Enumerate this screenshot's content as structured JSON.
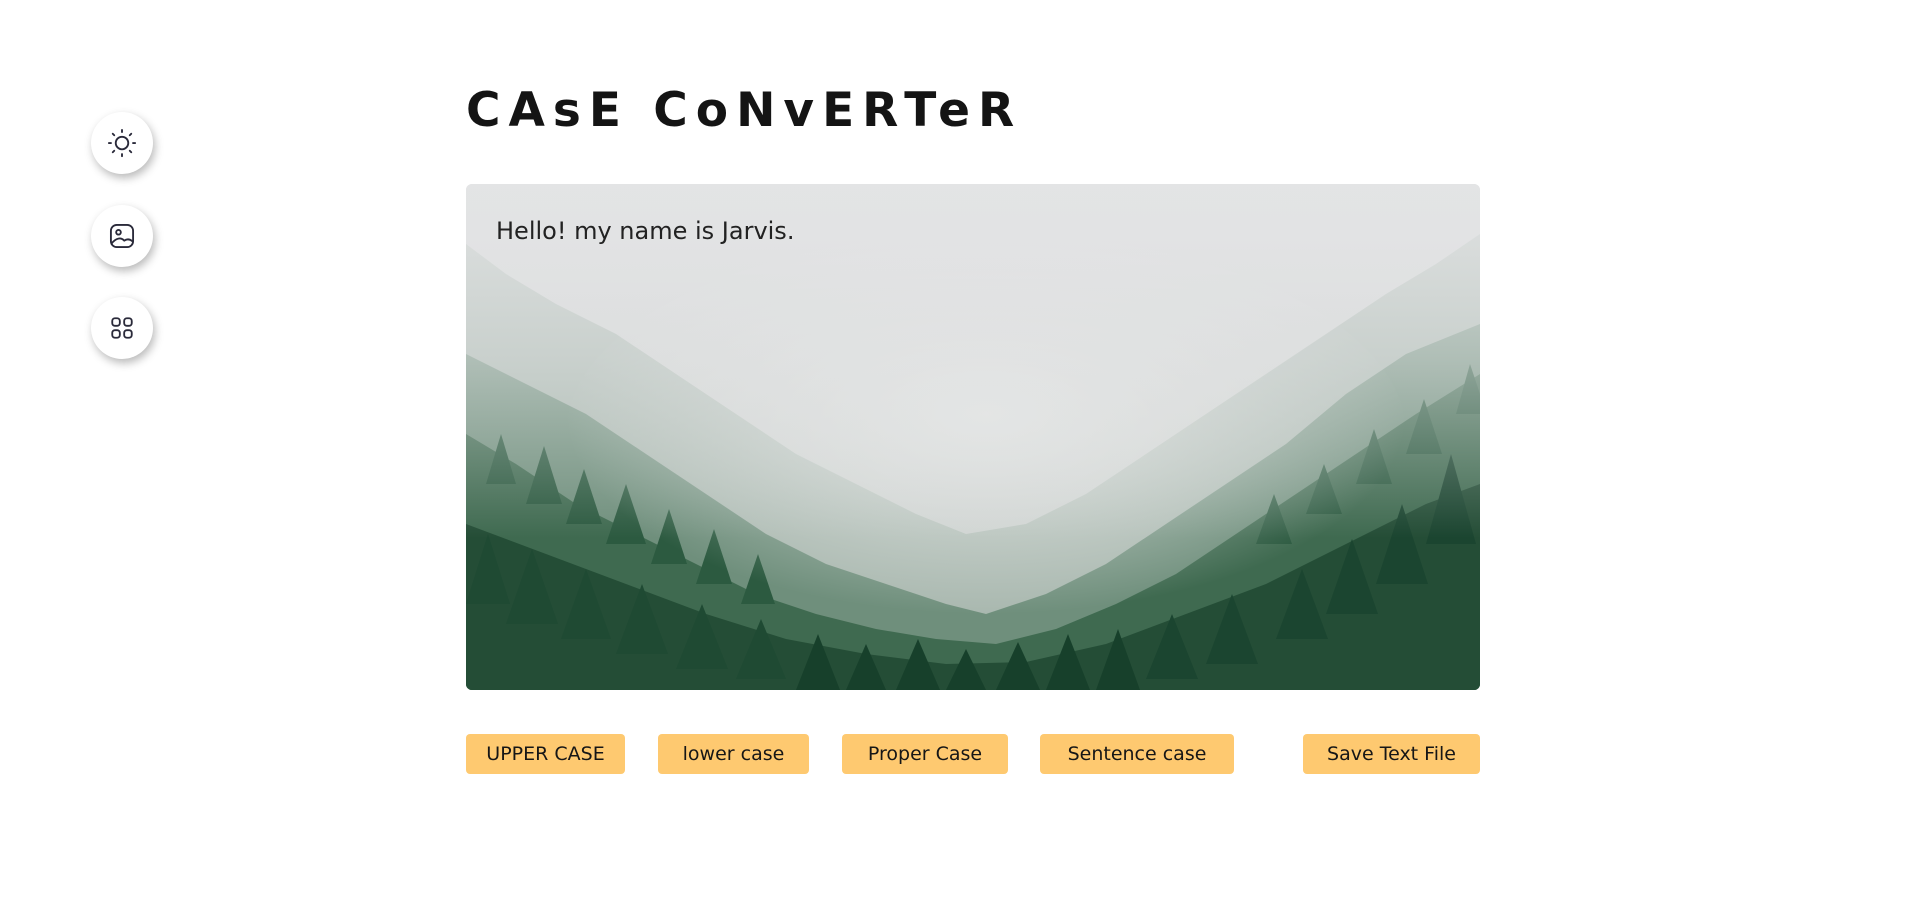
{
  "app": {
    "title": "CAsE CoNvERTeR"
  },
  "sidebar": {
    "buttons": [
      {
        "name": "theme",
        "icon": "sun-icon"
      },
      {
        "name": "background",
        "icon": "image-icon"
      },
      {
        "name": "apps",
        "icon": "grid-icon"
      }
    ]
  },
  "editor": {
    "text": "Hello! my name is Jarvis."
  },
  "actions": {
    "upper": "UPPER CASE",
    "lower": "lower case",
    "proper": "Proper Case",
    "sentence": "Sentence case",
    "save": "Save Text File"
  },
  "colors": {
    "button_bg": "#fec970",
    "title": "#141414",
    "icon": "#2a2a3a"
  }
}
